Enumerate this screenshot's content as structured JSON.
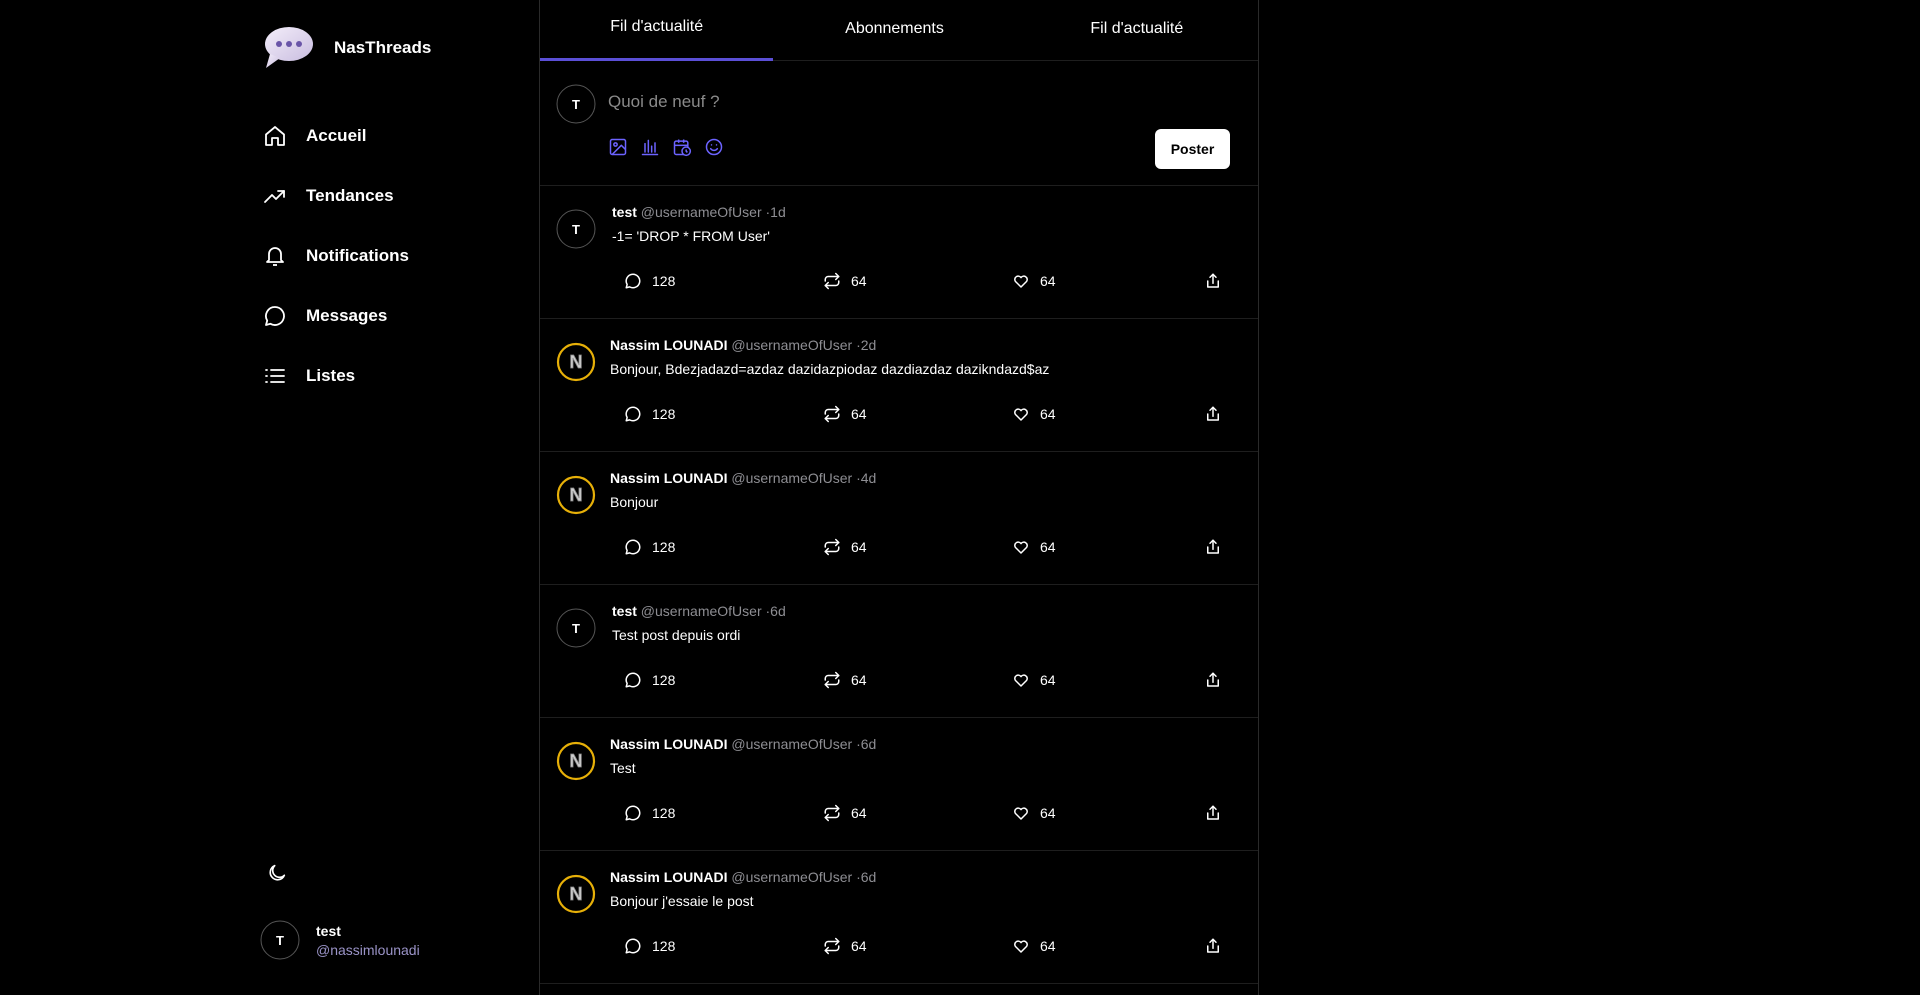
{
  "app": {
    "name": "NasThreads"
  },
  "sidebar": {
    "items": [
      {
        "label": "Accueil",
        "icon": "home-icon"
      },
      {
        "label": "Tendances",
        "icon": "trending-icon"
      },
      {
        "label": "Notifications",
        "icon": "bell-icon"
      },
      {
        "label": "Messages",
        "icon": "message-icon"
      },
      {
        "label": "Listes",
        "icon": "list-icon"
      }
    ],
    "theme_icon": "moon-icon",
    "user": {
      "initial": "T",
      "name": "test",
      "handle": "@nassimlounadi"
    }
  },
  "tabs": [
    {
      "label": "Fil d'actualité",
      "active": true
    },
    {
      "label": "Abonnements",
      "active": false
    },
    {
      "label": "Fil d'actualité",
      "active": false
    }
  ],
  "composer": {
    "avatar_initial": "T",
    "placeholder": "Quoi de neuf ?",
    "tools": [
      "image-icon",
      "poll-icon",
      "schedule-icon",
      "emoji-icon"
    ],
    "post_label": "Poster"
  },
  "posts": [
    {
      "avatar": "T",
      "name": "test",
      "handle": "@usernameOfUser",
      "dot": "·",
      "time": "1d",
      "text": "-1= 'DROP * FROM User'",
      "replies": "128",
      "reposts": "64",
      "likes": "64"
    },
    {
      "avatar": "N",
      "name": "Nassim LOUNADI",
      "handle": "@usernameOfUser",
      "dot": "·",
      "time": "2d",
      "text": "Bonjour, Bdezjadazd=azdaz dazidazpiodaz dazdiazdaz dazikndazd$az",
      "replies": "128",
      "reposts": "64",
      "likes": "64"
    },
    {
      "avatar": "N",
      "name": "Nassim LOUNADI",
      "handle": "@usernameOfUser",
      "dot": "·",
      "time": "4d",
      "text": "Bonjour",
      "replies": "128",
      "reposts": "64",
      "likes": "64"
    },
    {
      "avatar": "T",
      "name": "test",
      "handle": "@usernameOfUser",
      "dot": "·",
      "time": "6d",
      "text": "Test post depuis ordi",
      "replies": "128",
      "reposts": "64",
      "likes": "64"
    },
    {
      "avatar": "N",
      "name": "Nassim LOUNADI",
      "handle": "@usernameOfUser",
      "dot": "·",
      "time": "6d",
      "text": "Test",
      "replies": "128",
      "reposts": "64",
      "likes": "64"
    },
    {
      "avatar": "N",
      "name": "Nassim LOUNADI",
      "handle": "@usernameOfUser",
      "dot": "·",
      "time": "6d",
      "text": "Bonjour j'essaie le post",
      "replies": "128",
      "reposts": "64",
      "likes": "64"
    }
  ],
  "colors": {
    "accent": "#5b4fd6",
    "background": "#000000",
    "avatar_ring": "#e7b008",
    "handle": "#8e8e93"
  }
}
